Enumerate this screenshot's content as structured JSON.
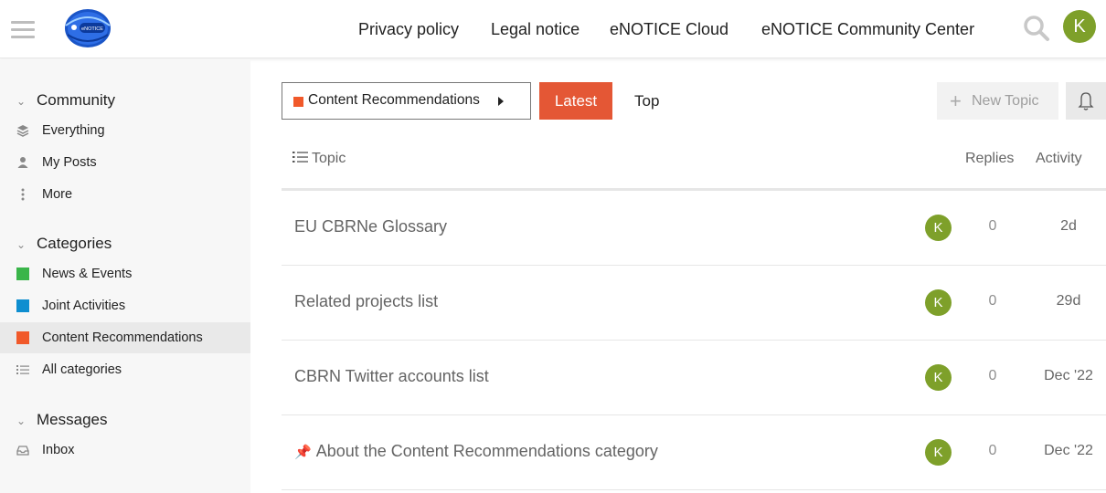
{
  "header": {
    "logo_text": "eNOTICE",
    "nav": [
      "Privacy policy",
      "Legal notice",
      "eNOTICE Cloud",
      "eNOTICE Community Center"
    ],
    "user_initial": "K",
    "avatar_color": "#7ea02a"
  },
  "sidebar": {
    "community": {
      "label": "Community",
      "items": [
        {
          "label": "Everything",
          "icon": "layers-icon"
        },
        {
          "label": "My Posts",
          "icon": "user-icon"
        },
        {
          "label": "More",
          "icon": "more-vertical-icon"
        }
      ]
    },
    "categories": {
      "label": "Categories",
      "items": [
        {
          "label": "News & Events",
          "color": "#3ab54a"
        },
        {
          "label": "Joint Activities",
          "color": "#0e8ed0"
        },
        {
          "label": "Content Recommendations",
          "color": "#f1592a",
          "active": true
        },
        {
          "label": "All categories",
          "icon": "list-icon"
        }
      ]
    },
    "messages": {
      "label": "Messages",
      "items": [
        {
          "label": "Inbox",
          "icon": "inbox-icon"
        }
      ]
    }
  },
  "main": {
    "category_selector": {
      "label": "Content Recommendations",
      "color": "#f1592a"
    },
    "tabs": {
      "latest": "Latest",
      "top": "Top"
    },
    "accent": "#e45735",
    "new_topic": "New Topic",
    "columns": {
      "topic": "Topic",
      "replies": "Replies",
      "activity": "Activity"
    },
    "topics": [
      {
        "title": "EU CBRNe Glossary",
        "poster": "K",
        "replies": "0",
        "activity": "2d",
        "pinned": false
      },
      {
        "title": "Related projects list",
        "poster": "K",
        "replies": "0",
        "activity": "29d",
        "pinned": false
      },
      {
        "title": "CBRN Twitter accounts list",
        "poster": "K",
        "replies": "0",
        "activity": "Dec '22",
        "pinned": false
      },
      {
        "title": "About the Content Recommendations category",
        "poster": "K",
        "replies": "0",
        "activity": "Dec '22",
        "pinned": true
      }
    ]
  }
}
